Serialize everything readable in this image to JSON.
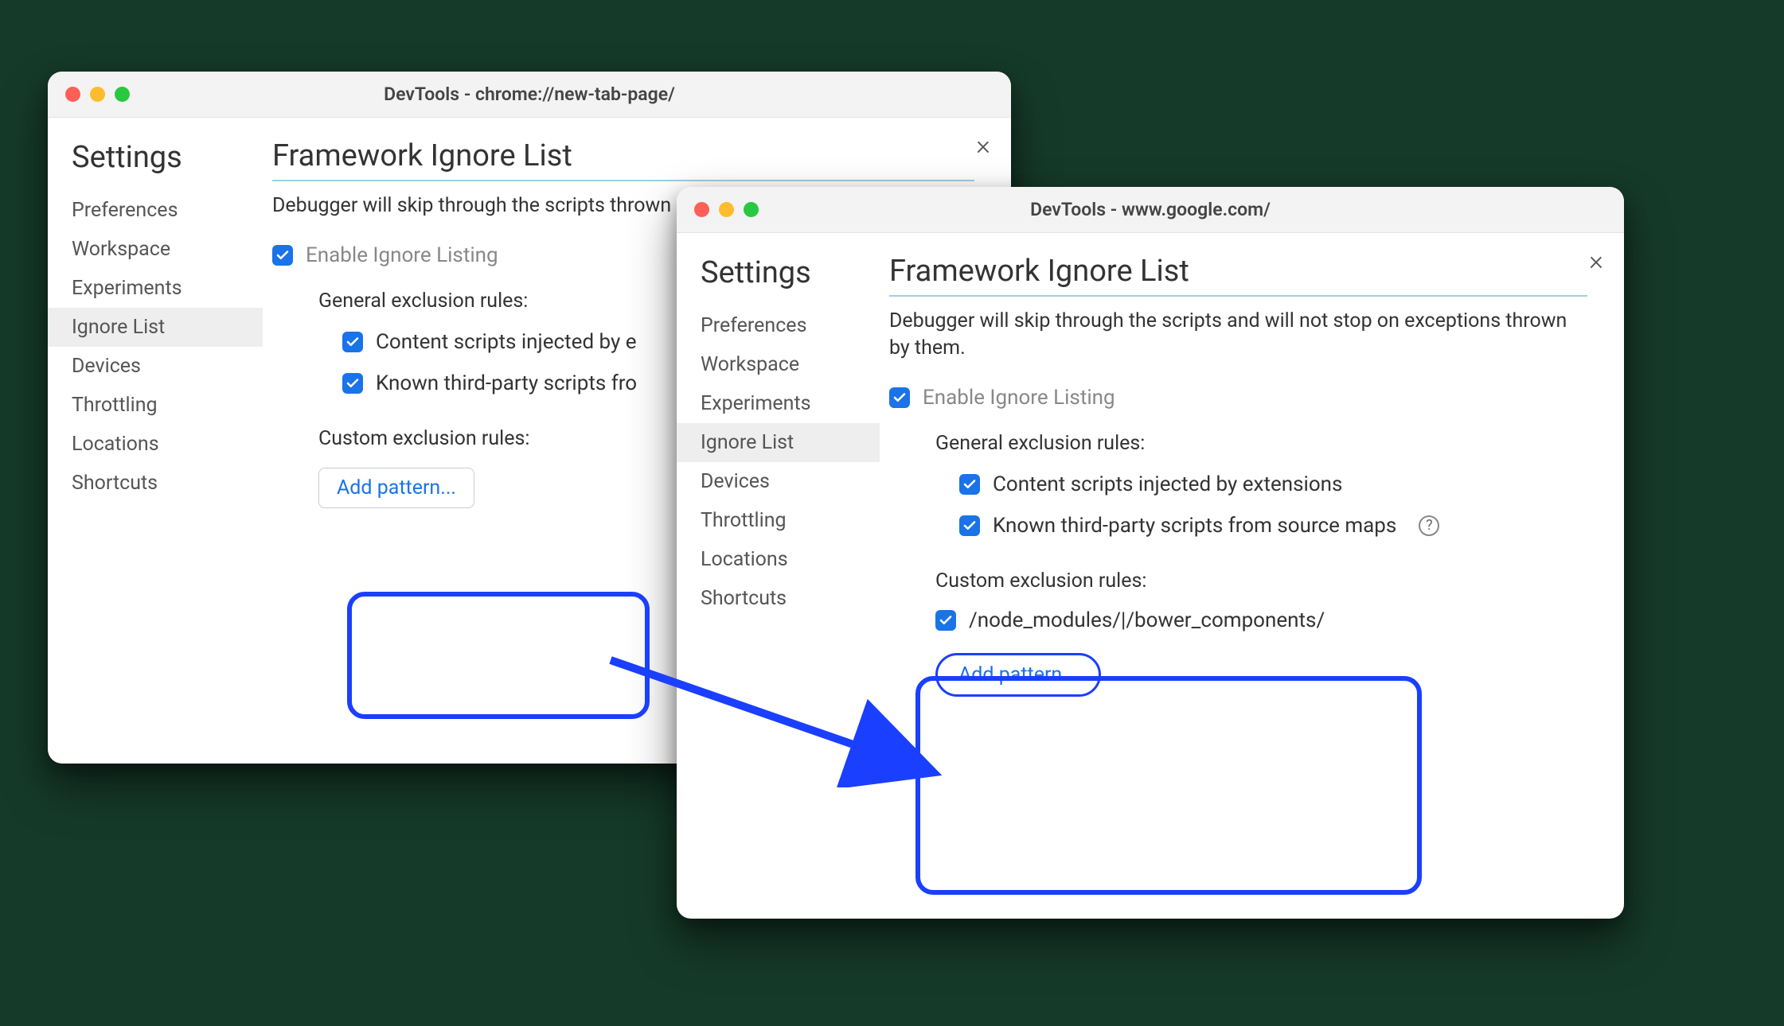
{
  "windows": {
    "left": {
      "title": "DevTools - chrome://new-tab-page/",
      "sidebar_title": "Settings",
      "sidebar_items": [
        "Preferences",
        "Workspace",
        "Experiments",
        "Ignore List",
        "Devices",
        "Throttling",
        "Locations",
        "Shortcuts"
      ],
      "heading": "Framework Ignore List",
      "description_visible": "Debugger will skip through the scripts thrown by them.",
      "enable_label": "Enable Ignore Listing",
      "general_rules_label": "General exclusion rules:",
      "rule_content_scripts_visible": "Content scripts injected by e",
      "rule_known_third_party_visible": "Known third-party scripts fro",
      "custom_rules_label": "Custom exclusion rules:",
      "add_pattern_label": "Add pattern..."
    },
    "right": {
      "title": "DevTools - www.google.com/",
      "sidebar_title": "Settings",
      "sidebar_items": [
        "Preferences",
        "Workspace",
        "Experiments",
        "Ignore List",
        "Devices",
        "Throttling",
        "Locations",
        "Shortcuts"
      ],
      "heading": "Framework Ignore List",
      "description": "Debugger will skip through the scripts and will not stop on exceptions thrown by them.",
      "enable_label": "Enable Ignore Listing",
      "general_rules_label": "General exclusion rules:",
      "rule_content_scripts": "Content scripts injected by extensions",
      "rule_known_third_party": "Known third-party scripts from source maps",
      "custom_rules_label": "Custom exclusion rules:",
      "custom_pattern": "/node_modules/|/bower_components/",
      "add_pattern_label": "Add pattern..."
    }
  },
  "colors": {
    "accent_checkbox": "#1a73e8",
    "highlight_border": "#1a3fff"
  }
}
